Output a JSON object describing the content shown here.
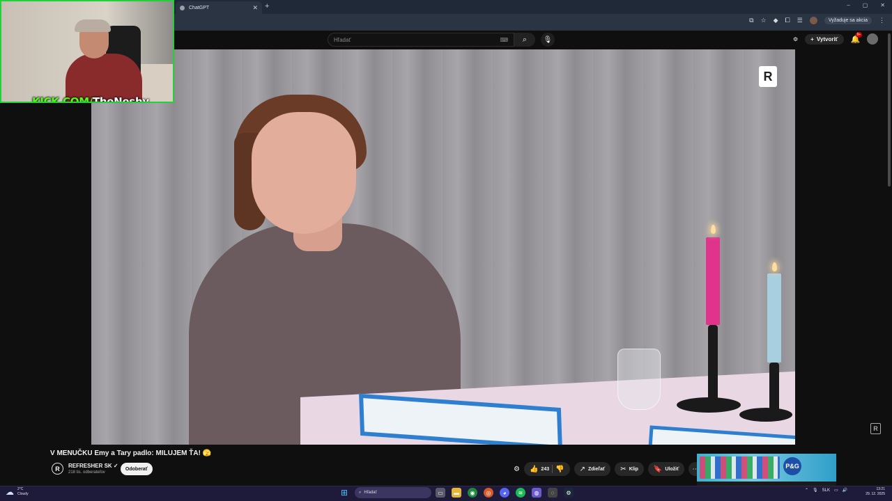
{
  "browser": {
    "tab_title": "ChatGPT",
    "new_tab": "+",
    "update_button": "Vyžaduje sa akcia",
    "window_controls": [
      "–",
      "▢",
      "✕"
    ]
  },
  "youtube": {
    "search_placeholder": "Hľadať",
    "create_label": "Vytvoriť",
    "notification_count": "9+"
  },
  "webcam": {
    "site": "KICK.COM/",
    "username": "TheNeshy"
  },
  "video": {
    "title": "V MENUČKU Emy a Tary padlo: MILUJEM ŤA! 🫣",
    "channel_name": "REFRESHER SK ✓",
    "subscribers": "218 tis. odberateľov",
    "subscribe_label": "Odoberať",
    "like_count": "243",
    "share_label": "Zdieľať",
    "clip_label": "Klip",
    "save_label": "Uložiť",
    "more_label": "⋯",
    "channel_logo": "R"
  },
  "ad": {
    "brand": "P&G"
  },
  "taskbar": {
    "weather_temp": "2°C",
    "weather_desc": "Cloudy",
    "search_placeholder": "Hľadať",
    "language": "SLK",
    "time": "13:21",
    "date": "29. 12. 2025"
  },
  "colors": {
    "kick_green": "#53fc18",
    "webcam_border": "#22d13a",
    "board_blue": "#2f7fd0",
    "candle_pink": "#e0348c",
    "candle_blue": "#a8cfe0"
  },
  "icons": [
    "tab-favicon-icon",
    "close-icon",
    "search-icon",
    "keyboard-icon",
    "mic-icon",
    "create-icon",
    "bell-icon",
    "like-icon",
    "dislike-icon",
    "share-icon",
    "clip-icon",
    "save-icon",
    "windows-start-icon",
    "weather-icon"
  ]
}
